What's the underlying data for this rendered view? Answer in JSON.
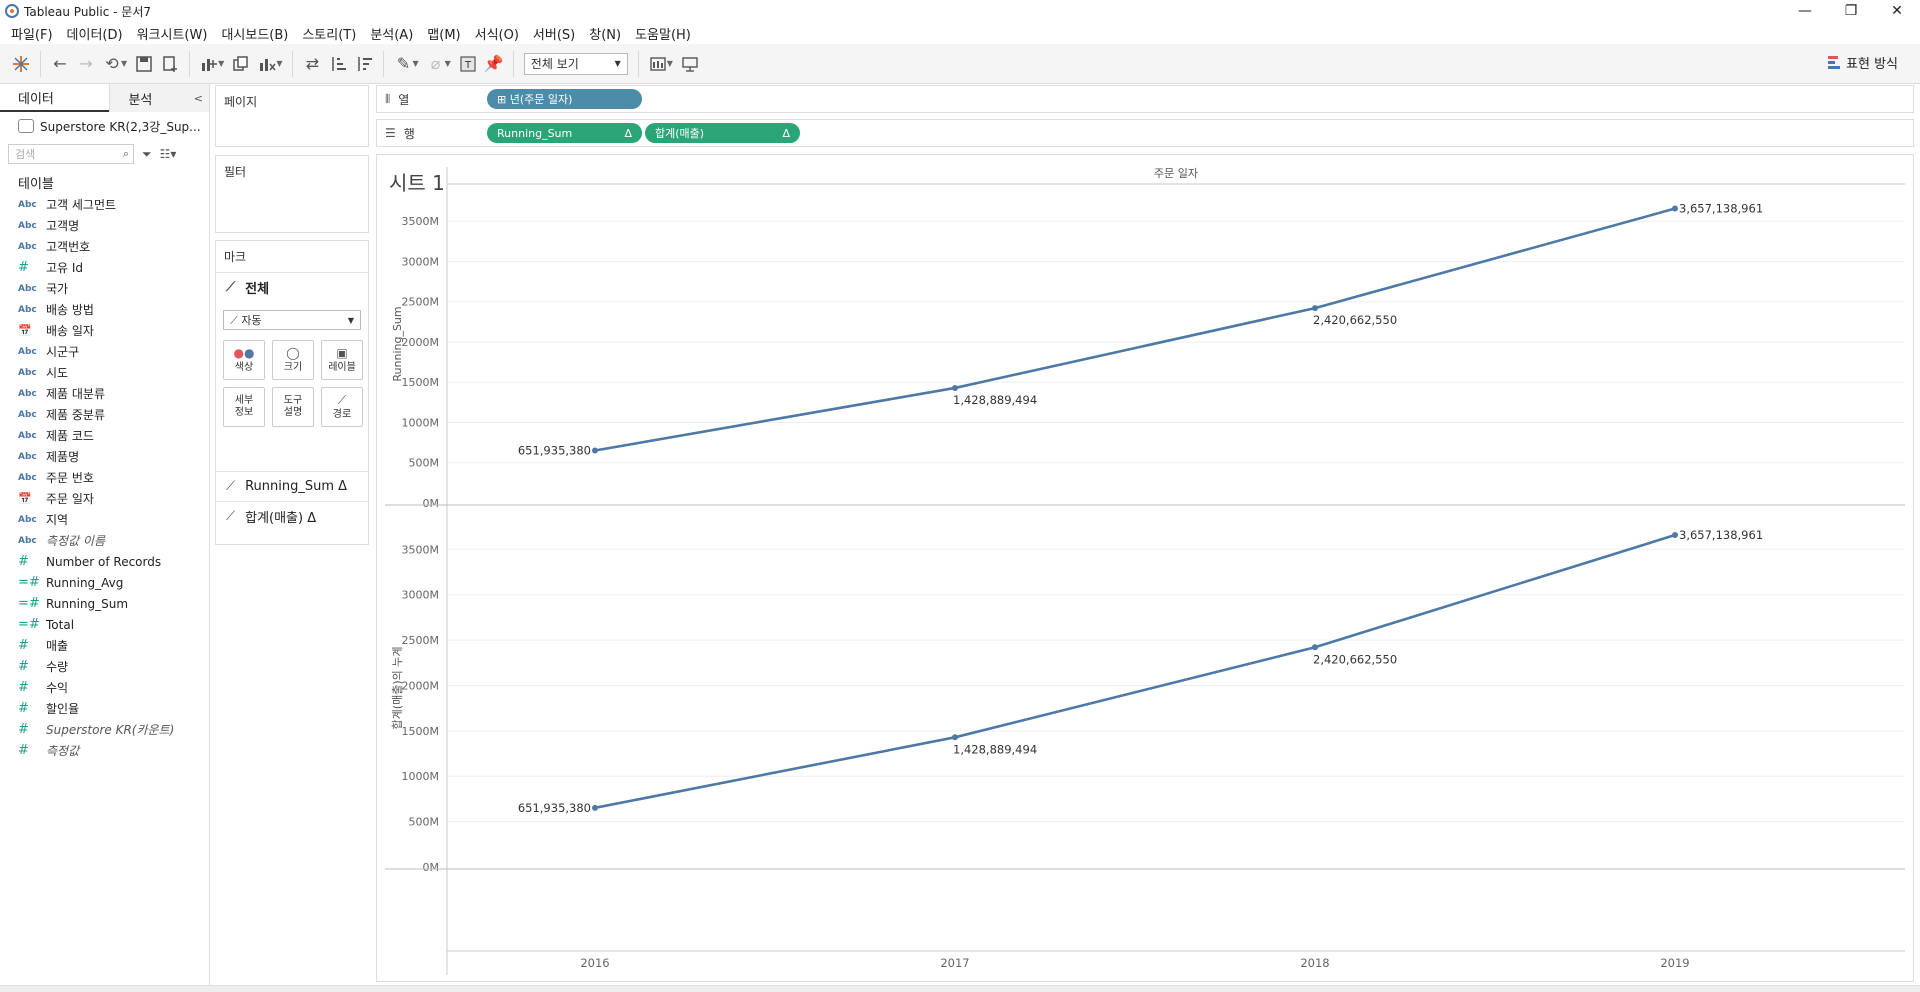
{
  "window": {
    "title": "Tableau Public - 문서7",
    "controls": [
      "—",
      "❐",
      "✕"
    ]
  },
  "menu": [
    "파일(F)",
    "데이터(D)",
    "워크시트(W)",
    "대시보드(B)",
    "스토리(T)",
    "분석(A)",
    "맵(M)",
    "서식(O)",
    "서버(S)",
    "창(N)",
    "도움말(H)"
  ],
  "toolbar": {
    "fit_label": "전체 보기",
    "show_me_label": "표현 방식"
  },
  "data_pane": {
    "tab_data": "데이터",
    "tab_analytics": "분석",
    "datasource": "Superstore KR(2,3강_Sup...",
    "search_placeholder": "검색",
    "tables_title": "테이블",
    "dimensions": [
      {
        "type": "Abc",
        "name": "고객 세그먼트"
      },
      {
        "type": "Abc",
        "name": "고객명"
      },
      {
        "type": "Abc",
        "name": "고객번호"
      },
      {
        "type": "#",
        "name": "고유 Id"
      },
      {
        "type": "Abc",
        "name": "국가"
      },
      {
        "type": "Abc",
        "name": "배송 방법"
      },
      {
        "type": "date",
        "name": "배송 일자"
      },
      {
        "type": "Abc",
        "name": "시군구"
      },
      {
        "type": "Abc",
        "name": "시도"
      },
      {
        "type": "Abc",
        "name": "제품 대분류"
      },
      {
        "type": "Abc",
        "name": "제품 중분류"
      },
      {
        "type": "Abc",
        "name": "제품 코드"
      },
      {
        "type": "Abc",
        "name": "제품명"
      },
      {
        "type": "Abc",
        "name": "주문 번호"
      },
      {
        "type": "date",
        "name": "주문 일자"
      },
      {
        "type": "Abc",
        "name": "지역"
      },
      {
        "type": "Abc",
        "name": "측정값 이름",
        "italic": true
      }
    ],
    "measures": [
      {
        "type": "#",
        "name": "Number of Records"
      },
      {
        "type": "=#",
        "name": "Running_Avg"
      },
      {
        "type": "=#",
        "name": "Running_Sum"
      },
      {
        "type": "=#",
        "name": "Total"
      },
      {
        "type": "#",
        "name": "매출"
      },
      {
        "type": "#",
        "name": "수량"
      },
      {
        "type": "#",
        "name": "수익"
      },
      {
        "type": "#",
        "name": "할인율"
      },
      {
        "type": "#",
        "name": "Superstore KR(카운트)",
        "italic": true
      },
      {
        "type": "#",
        "name": "측정값",
        "italic": true
      }
    ]
  },
  "cards": {
    "pages": "페이지",
    "filters": "필터",
    "marks": "마크",
    "marks_all": "전체",
    "mark_type": "자동",
    "buttons": [
      "색상",
      "크기",
      "레이블",
      "세부\n정보",
      "도구\n설명",
      "경로"
    ],
    "marks_measures": [
      "Running_Sum Δ",
      "합계(매출) Δ"
    ]
  },
  "shelves": {
    "columns_label": "열",
    "rows_label": "행",
    "columns_pills": [
      "⊞ 년(주문 일자)"
    ],
    "rows_pills": [
      {
        "label": "Running_Sum",
        "delta": "Δ"
      },
      {
        "label": "합계(매출)",
        "delta": "Δ"
      }
    ]
  },
  "chart_data": {
    "type": "line",
    "title": "시트 1",
    "header": "주문 일자",
    "categories": [
      "2016",
      "2017",
      "2018",
      "2019"
    ],
    "series": [
      {
        "name": "Running_Sum",
        "values": [
          651935380,
          1428889494,
          2420662550,
          3657138961
        ],
        "labels": [
          "651,935,380",
          "1,428,889,494",
          "2,420,662,550",
          "3,657,138,961"
        ]
      },
      {
        "name": "합계(매출)의 누계",
        "values": [
          651935380,
          1428889494,
          2420662550,
          3657138961
        ],
        "labels": [
          "651,935,380",
          "1,428,889,494",
          "2,420,662,550",
          "3,657,138,961"
        ]
      }
    ],
    "yticks": [
      "0M",
      "500M",
      "1000M",
      "1500M",
      "2000M",
      "2500M",
      "3000M",
      "3500M"
    ],
    "ylim": [
      0,
      3900000000
    ],
    "color": "#4e79a7",
    "grid": true
  }
}
